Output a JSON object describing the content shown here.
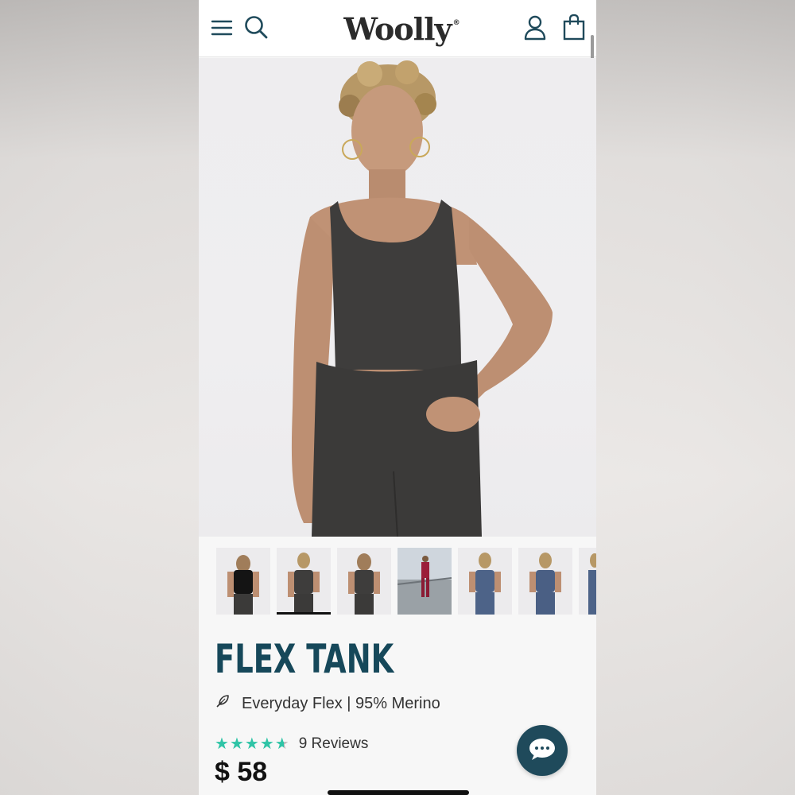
{
  "header": {
    "logo_text": "Woolly",
    "logo_mark": "®",
    "icons": [
      "menu-icon",
      "search-icon",
      "account-icon",
      "cart-icon"
    ]
  },
  "product": {
    "title": "FLEX TANK",
    "subtitle": "Everyday Flex | 95% Merino",
    "subtitle_icon": "feather-icon",
    "rating": 4.5,
    "reviews_label": "9 Reviews",
    "price": "$ 58"
  },
  "gallery": {
    "selected_index": 1,
    "thumbnails": [
      {
        "name": "back-black"
      },
      {
        "name": "front-charcoal"
      },
      {
        "name": "back-charcoal"
      },
      {
        "name": "outdoor-red"
      },
      {
        "name": "front-blue"
      },
      {
        "name": "front-blue-2"
      },
      {
        "name": "side-blue-partial"
      }
    ]
  },
  "colors": {
    "title": "#16485a",
    "stars": "#2ec4a6",
    "chat_button": "#1f4a5b"
  }
}
